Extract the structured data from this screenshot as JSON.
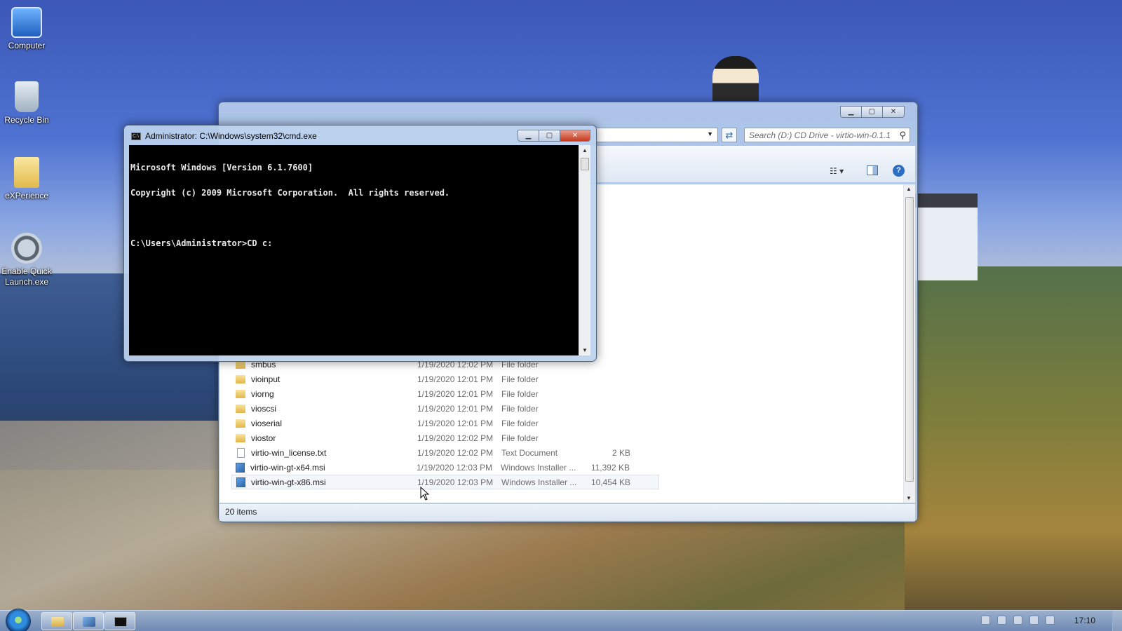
{
  "desktop": {
    "icons": [
      {
        "label": "Computer",
        "icon": "computer-icon"
      },
      {
        "label": "Recycle Bin",
        "icon": "recycle-bin-icon"
      },
      {
        "label": "eXPerience",
        "icon": "folder-icon"
      },
      {
        "label": "Enable Quick Launch.exe",
        "icon": "quick-launch-icon"
      }
    ]
  },
  "explorer": {
    "search_placeholder": "Search (D:) CD Drive - virtio-win-0.1.1",
    "status_text": "20 items",
    "files": [
      {
        "name": "smbus",
        "date": "1/19/2020 12:02 PM",
        "type": "File folder",
        "size": "",
        "icon": "folder-icon"
      },
      {
        "name": "vioinput",
        "date": "1/19/2020 12:01 PM",
        "type": "File folder",
        "size": "",
        "icon": "folder-icon"
      },
      {
        "name": "viorng",
        "date": "1/19/2020 12:01 PM",
        "type": "File folder",
        "size": "",
        "icon": "folder-icon"
      },
      {
        "name": "vioscsi",
        "date": "1/19/2020 12:01 PM",
        "type": "File folder",
        "size": "",
        "icon": "folder-icon"
      },
      {
        "name": "vioserial",
        "date": "1/19/2020 12:01 PM",
        "type": "File folder",
        "size": "",
        "icon": "folder-icon"
      },
      {
        "name": "viostor",
        "date": "1/19/2020 12:02 PM",
        "type": "File folder",
        "size": "",
        "icon": "folder-icon"
      },
      {
        "name": "virtio-win_license.txt",
        "date": "1/19/2020 12:02 PM",
        "type": "Text Document",
        "size": "2 KB",
        "icon": "text-document-icon"
      },
      {
        "name": "virtio-win-gt-x64.msi",
        "date": "1/19/2020 12:03 PM",
        "type": "Windows Installer ...",
        "size": "11,392 KB",
        "icon": "installer-icon"
      },
      {
        "name": "virtio-win-gt-x86.msi",
        "date": "1/19/2020 12:03 PM",
        "type": "Windows Installer ...",
        "size": "10,454 KB",
        "icon": "installer-icon"
      }
    ]
  },
  "cmd": {
    "title": "Administrator: C:\\Windows\\system32\\cmd.exe",
    "lines": [
      "Microsoft Windows [Version 6.1.7600]",
      "Copyright (c) 2009 Microsoft Corporation.  All rights reserved.",
      "",
      "C:\\Users\\Administrator>CD c:"
    ]
  },
  "taskbar": {
    "clock": "17:10",
    "buttons": [
      "windows-explorer",
      "installer",
      "command-prompt"
    ]
  },
  "colors": {
    "selection": "#f3f6fa",
    "console_bg": "#000000",
    "console_fg": "#e8e8e8",
    "close_button": "#c5391e"
  }
}
